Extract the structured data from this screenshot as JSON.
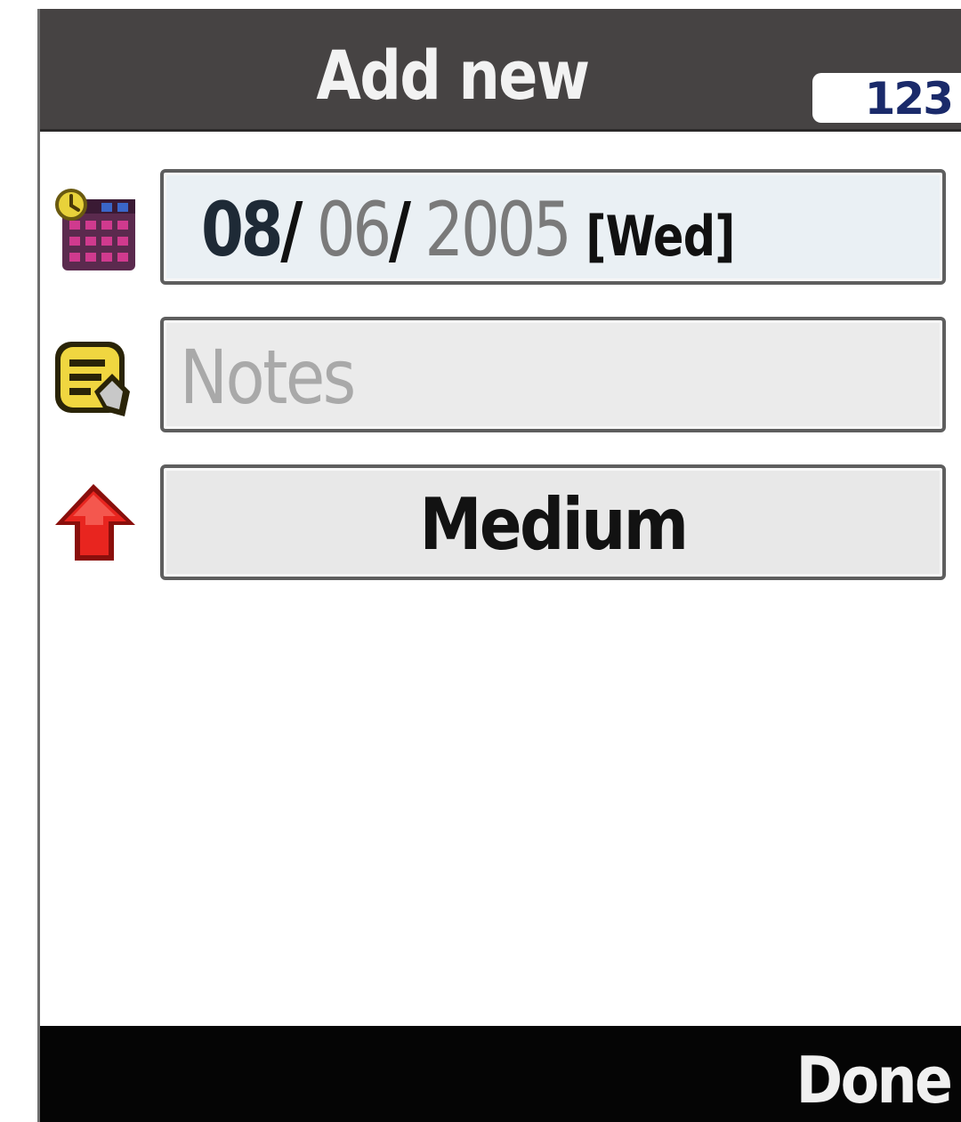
{
  "header": {
    "title": "Add new",
    "input_mode": "123"
  },
  "form": {
    "date": {
      "month": "08",
      "separator_1": "/",
      "day": "06",
      "separator_2": "/",
      "year": "2005",
      "weekday": "[Wed]"
    },
    "notes": {
      "placeholder": "Notes",
      "value": ""
    },
    "priority": {
      "value": "Medium"
    }
  },
  "softkeys": {
    "right": "Done"
  },
  "icons": {
    "date": "calendar-icon",
    "notes": "note-edit-icon",
    "priority": "priority-up-arrow-icon"
  },
  "colors": {
    "title_bar": "#464343",
    "softkey_bar": "#050505",
    "priority_arrow": "#e8251f",
    "input_mode_text": "#1a2a6a"
  }
}
